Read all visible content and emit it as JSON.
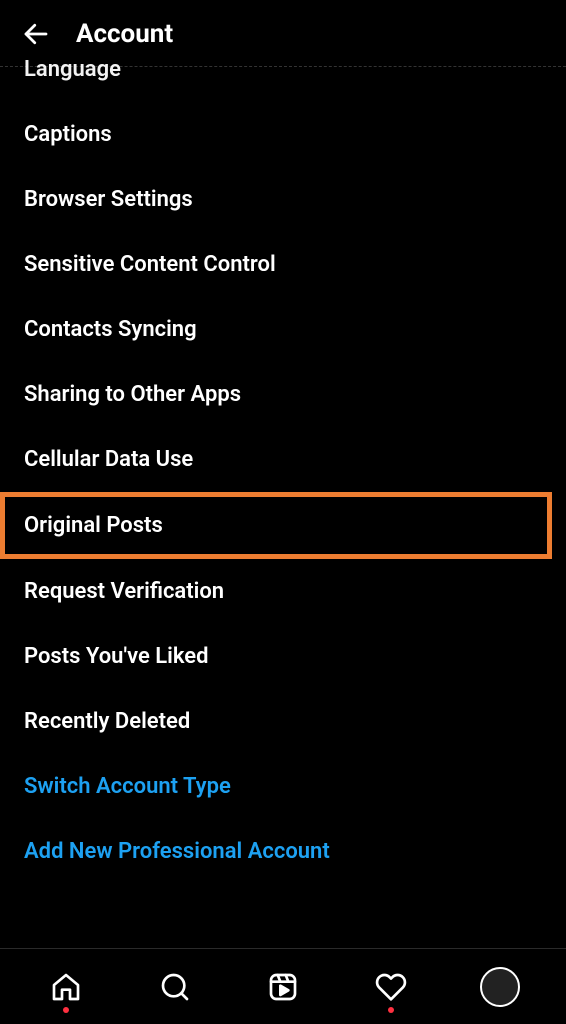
{
  "header": {
    "title": "Account"
  },
  "items": [
    {
      "label": "Language",
      "partial": true,
      "link": false,
      "highlighted": false,
      "dot": false
    },
    {
      "label": "Captions",
      "partial": false,
      "link": false,
      "highlighted": false,
      "dot": false
    },
    {
      "label": "Browser Settings",
      "partial": false,
      "link": false,
      "highlighted": false,
      "dot": false
    },
    {
      "label": "Sensitive Content Control",
      "partial": false,
      "link": false,
      "highlighted": false,
      "dot": false
    },
    {
      "label": "Contacts Syncing",
      "partial": false,
      "link": false,
      "highlighted": false,
      "dot": false
    },
    {
      "label": "Sharing to Other Apps",
      "partial": false,
      "link": false,
      "highlighted": false,
      "dot": false
    },
    {
      "label": "Cellular Data Use",
      "partial": false,
      "link": false,
      "highlighted": false,
      "dot": false
    },
    {
      "label": "Original Posts",
      "partial": false,
      "link": false,
      "highlighted": true,
      "dot": false
    },
    {
      "label": "Request Verification",
      "partial": false,
      "link": false,
      "highlighted": false,
      "dot": false
    },
    {
      "label": "Posts You've Liked",
      "partial": false,
      "link": false,
      "highlighted": false,
      "dot": false
    },
    {
      "label": "Recently Deleted",
      "partial": false,
      "link": false,
      "highlighted": false,
      "dot": false
    },
    {
      "label": "Switch Account Type",
      "partial": false,
      "link": true,
      "highlighted": false,
      "dot": false
    },
    {
      "label": "Add New Professional Account",
      "partial": false,
      "link": true,
      "highlighted": false,
      "dot": false
    }
  ],
  "tabs": {
    "home_dot": true,
    "activity_dot": true
  }
}
